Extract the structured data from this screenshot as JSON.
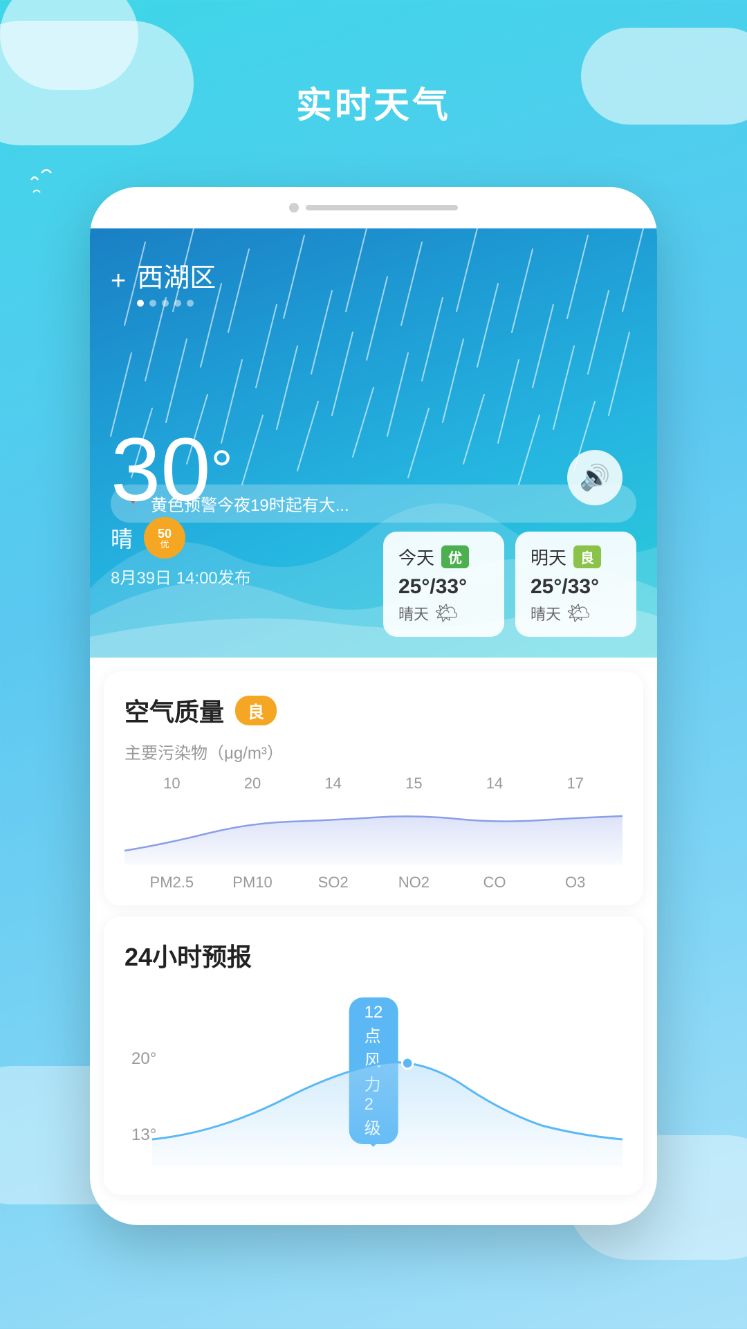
{
  "page": {
    "title": "实时天气",
    "background_gradient_start": "#3dd6e8",
    "background_gradient_end": "#a8e0f8"
  },
  "location": {
    "name": "西湖区",
    "add_label": "+",
    "dots": [
      true,
      false,
      false,
      false,
      false
    ]
  },
  "alert": {
    "icon": "📍",
    "text": "黄色预警今夜19时起有大..."
  },
  "current_weather": {
    "temperature": "30",
    "degree_symbol": "°",
    "description": "晴",
    "aqi_value": "50",
    "aqi_label": "优",
    "publish_time": "8月39日 14:00发布"
  },
  "forecast_today": {
    "label": "今天",
    "quality": "优",
    "quality_class": "you",
    "temp_range": "25°/33°",
    "desc": "晴天",
    "icon": "🌤"
  },
  "forecast_tomorrow": {
    "label": "明天",
    "quality": "良",
    "quality_class": "liang",
    "temp_range": "25°/33°",
    "desc": "晴天",
    "icon": "🌤"
  },
  "air_quality": {
    "section_title": "空气质量",
    "quality_level": "良",
    "pollutant_label": "主要污染物（μg/m³）",
    "pollutants": [
      {
        "name": "PM2.5",
        "value": "10"
      },
      {
        "name": "PM10",
        "value": "20"
      },
      {
        "name": "SO2",
        "value": "14"
      },
      {
        "name": "NO2",
        "value": "15"
      },
      {
        "name": "CO",
        "value": "14"
      },
      {
        "name": "O3",
        "value": "17"
      }
    ]
  },
  "forecast_24h": {
    "section_title": "24小时预报",
    "tooltip": "12点 风力2级",
    "temp_high_label": "20°",
    "temp_low_label": "13°"
  },
  "phone": {
    "notch_visible": true
  }
}
